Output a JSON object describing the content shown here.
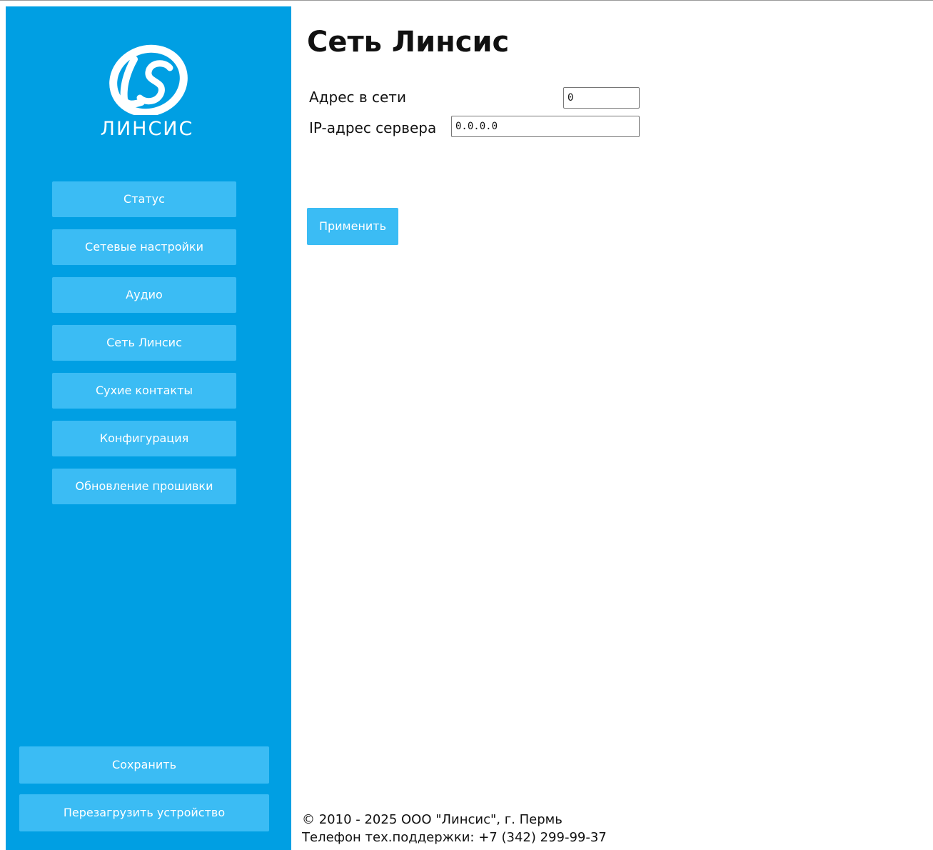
{
  "brand": {
    "logo_text": "ЛИНСИС",
    "accent": "#009fe3",
    "button_color": "#3bbcf4"
  },
  "page": {
    "title": "Сеть Линсис"
  },
  "sidebar": {
    "items": [
      {
        "label": "Статус"
      },
      {
        "label": "Сетевые настройки"
      },
      {
        "label": "Аудио"
      },
      {
        "label": "Сеть Линсис"
      },
      {
        "label": "Сухие контакты"
      },
      {
        "label": "Конфигурация"
      },
      {
        "label": "Обновление прошивки"
      }
    ],
    "save_label": "Сохранить",
    "reboot_label": "Перезагрузить устройство"
  },
  "form": {
    "network_address": {
      "label": "Адрес в сети",
      "value": "0"
    },
    "server_ip": {
      "label": "IP-адрес сервера",
      "value": "0.0.0.0"
    },
    "apply_label": "Применить"
  },
  "footer": {
    "copyright": "© 2010 - 2025 ООО \"Линсис\", г. Пермь",
    "support": "Телефон тех.поддержки: +7 (342) 299-99-37"
  }
}
